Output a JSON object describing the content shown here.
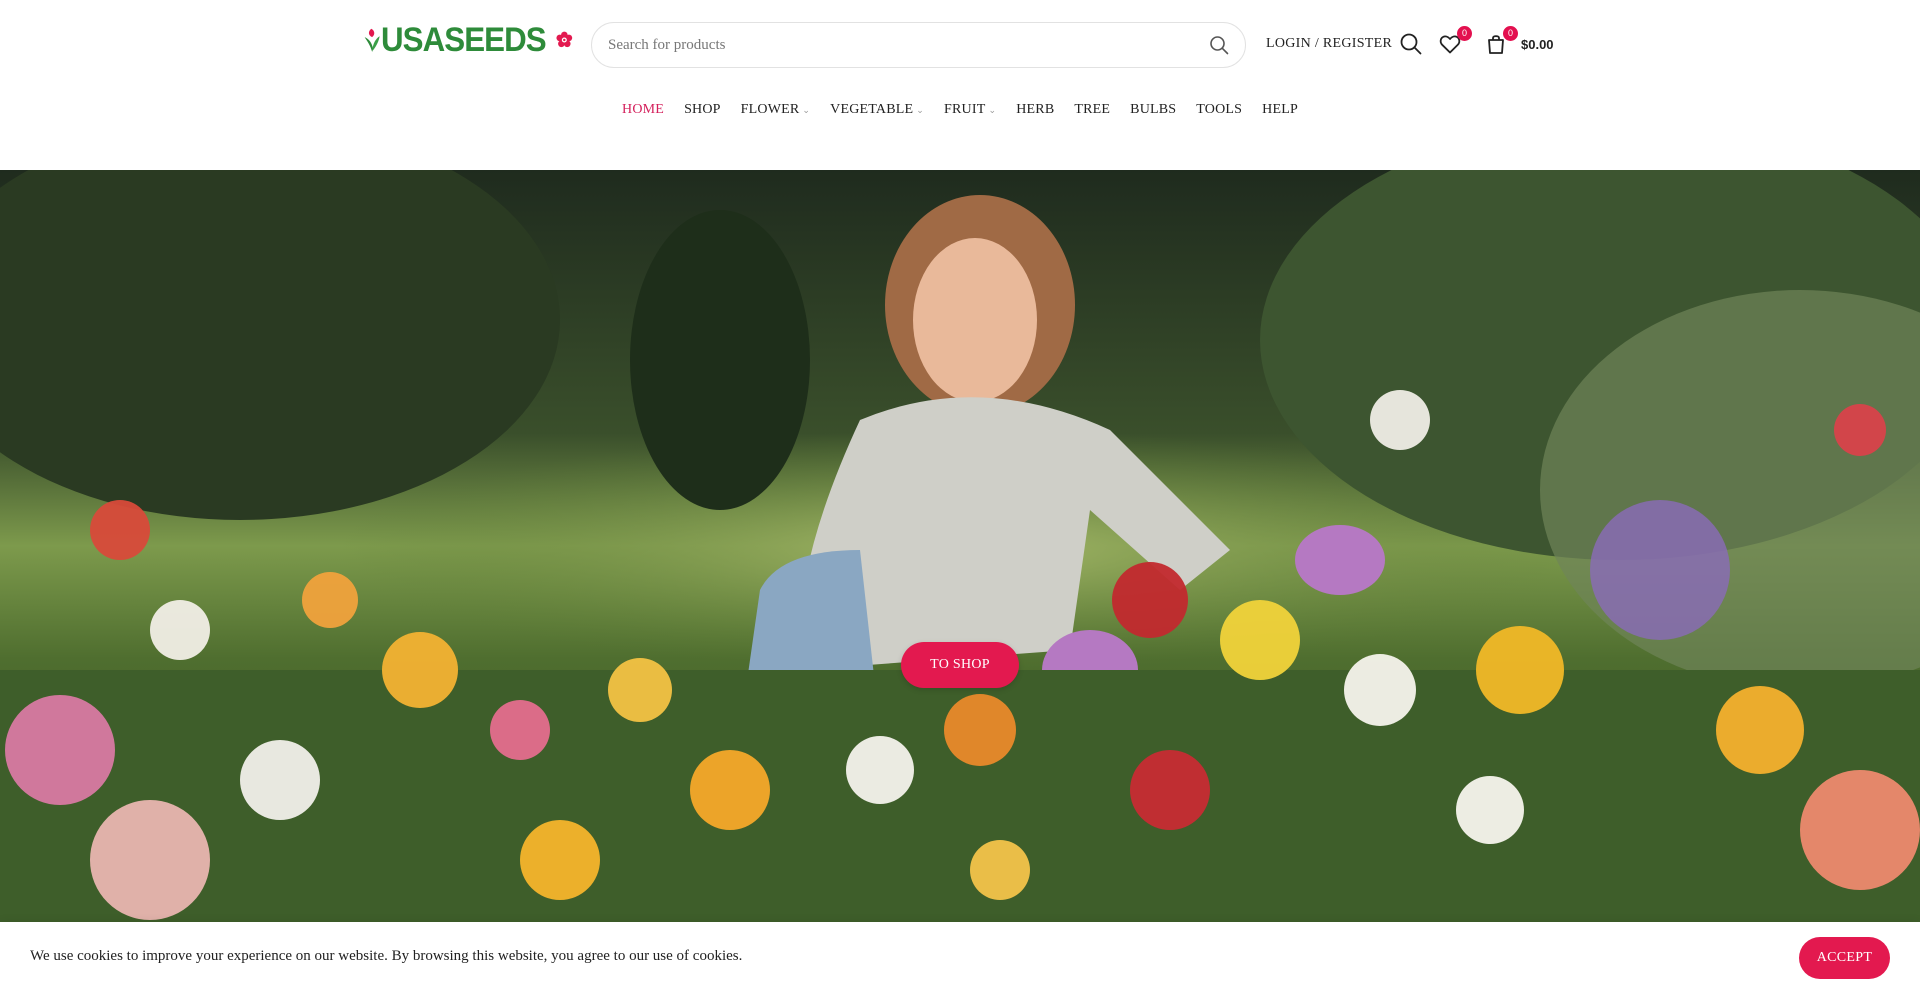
{
  "brand": {
    "name": "USASEEDS",
    "accent": "#e3194f",
    "green": "#2e8b3a"
  },
  "search": {
    "placeholder": "Search for products",
    "icon": "search-icon"
  },
  "header": {
    "login_label": "LOGIN / REGISTER",
    "wishlist_count": "0",
    "cart_count": "0",
    "cart_total": "$0.00"
  },
  "nav": {
    "items": [
      {
        "label": "HOME",
        "active": true,
        "dropdown": false
      },
      {
        "label": "SHOP",
        "active": false,
        "dropdown": false
      },
      {
        "label": "FLOWER",
        "active": false,
        "dropdown": true
      },
      {
        "label": "VEGETABLE",
        "active": false,
        "dropdown": true
      },
      {
        "label": "FRUIT",
        "active": false,
        "dropdown": true
      },
      {
        "label": "HERB",
        "active": false,
        "dropdown": false
      },
      {
        "label": "TREE",
        "active": false,
        "dropdown": false
      },
      {
        "label": "BULBS",
        "active": false,
        "dropdown": false
      },
      {
        "label": "TOOLS",
        "active": false,
        "dropdown": false
      },
      {
        "label": "HELP",
        "active": false,
        "dropdown": false
      }
    ]
  },
  "hero": {
    "cta_label": "TO SHOP"
  },
  "cookie": {
    "message": "We use cookies to improve your experience on our website. By browsing this website, you agree to our use of cookies.",
    "accept_label": "ACCEPT"
  }
}
